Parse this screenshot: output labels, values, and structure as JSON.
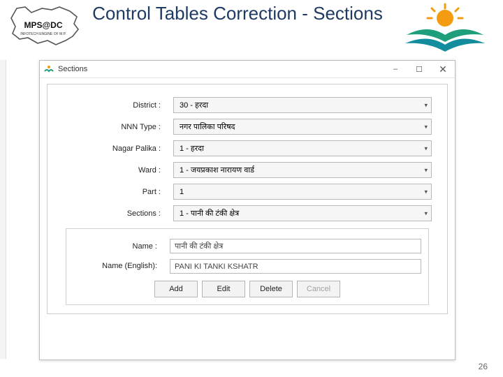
{
  "slide": {
    "title": "Control Tables Correction  - Sections",
    "page_number": "26"
  },
  "window": {
    "title": "Sections",
    "min_hint": "–",
    "max_hint": "☐",
    "close_hint": "✕"
  },
  "form": {
    "district_label": "District :",
    "district_value": "30 - हरदा",
    "nnn_type_label": "NNN Type :",
    "nnn_type_value": "नगर पालिका परिषद",
    "nagar_palika_label": "Nagar Palika :",
    "nagar_palika_value": "1 - हरदा",
    "ward_label": "Ward :",
    "ward_value": "1 - जयप्रकाश नारायण वार्ड",
    "part_label": "Part :",
    "part_value": "1",
    "sections_label": "Sections :",
    "sections_value": "1 - पानी की टंकी क्षेत्र"
  },
  "detail": {
    "name_label": "Name :",
    "name_value": "पानी की टंकी क्षेत्र",
    "name_en_label": "Name (English):",
    "name_en_value": "PANI KI TANKI KSHATR"
  },
  "buttons": {
    "add": "Add",
    "edit": "Edit",
    "delete": "Delete",
    "cancel": "Cancel"
  }
}
